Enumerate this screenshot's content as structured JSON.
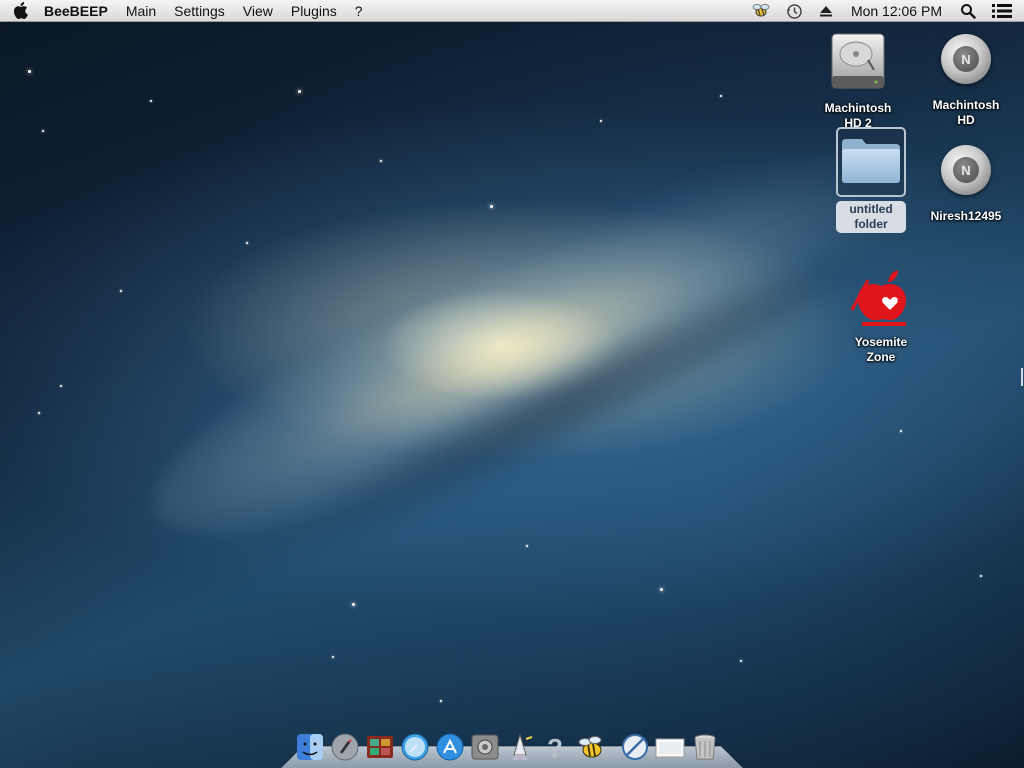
{
  "menubar": {
    "apple_icon": "apple-icon",
    "app_name": "BeeBEEP",
    "items": [
      "Main",
      "Settings",
      "View",
      "Plugins",
      "?"
    ],
    "status_icons": [
      "beebeep-status-icon",
      "time-machine-icon",
      "eject-icon"
    ],
    "clock": "Mon 12:06 PM",
    "right_icons": [
      "spotlight-search-icon",
      "notification-list-icon"
    ]
  },
  "desktop": {
    "icons": [
      {
        "label": "Machintosh HD 2",
        "icon": "hard-drive-icon"
      },
      {
        "label": "Machintosh HD",
        "icon": "disc-icon"
      },
      {
        "label": "untitled folder",
        "icon": "folder-icon",
        "selected": true
      },
      {
        "label": "Niresh12495",
        "icon": "disc-icon"
      },
      {
        "label": "Yosemite Zone",
        "icon": "yosemite-zone-icon"
      }
    ]
  },
  "dock": {
    "items": [
      "finder-icon",
      "launchpad-icon",
      "photo-booth-icon",
      "safari-icon",
      "app-store-icon",
      "system-preferences-icon",
      "wizard-icon",
      "help-icon",
      "beebeep-icon",
      "proxy-icon",
      "preview-icon",
      "trash-icon"
    ]
  },
  "colors": {
    "menubar_bg": "#e6e6e6",
    "label_text": "#ffffff",
    "folder_selection": "#d7dde3",
    "yosemite_red": "#e0151b"
  }
}
